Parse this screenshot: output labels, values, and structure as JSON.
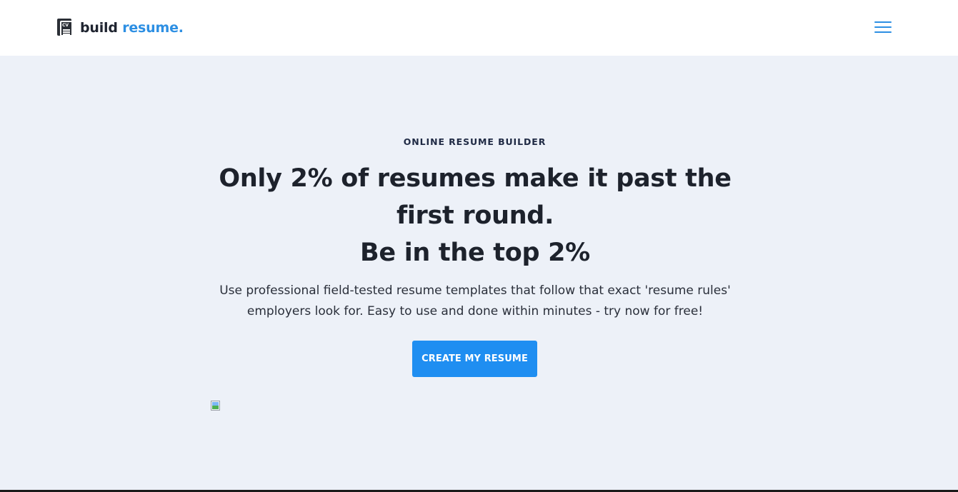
{
  "header": {
    "logo": {
      "icon": "cv-document-icon",
      "icon_text": "CV",
      "text_primary": "build",
      "text_accent": "resume."
    },
    "menu_icon": "hamburger-menu-icon"
  },
  "hero": {
    "eyebrow": "ONLINE RESUME BUILDER",
    "headline_lines": [
      "Only 2% of resumes make it past the",
      "first round.",
      "Be in the top 2%"
    ],
    "subtext": "Use professional field-tested resume templates that follow that exact 'resume rules' employers look for. Easy to use and done within minutes - try now for free!",
    "cta_label": "CREATE MY RESUME",
    "image_icon": "broken-image-icon"
  },
  "colors": {
    "accent": "#1f8ef1",
    "brand_blue": "#2d8fe3",
    "hero_background": "#edf1f8",
    "heading_text": "#1d222c"
  }
}
